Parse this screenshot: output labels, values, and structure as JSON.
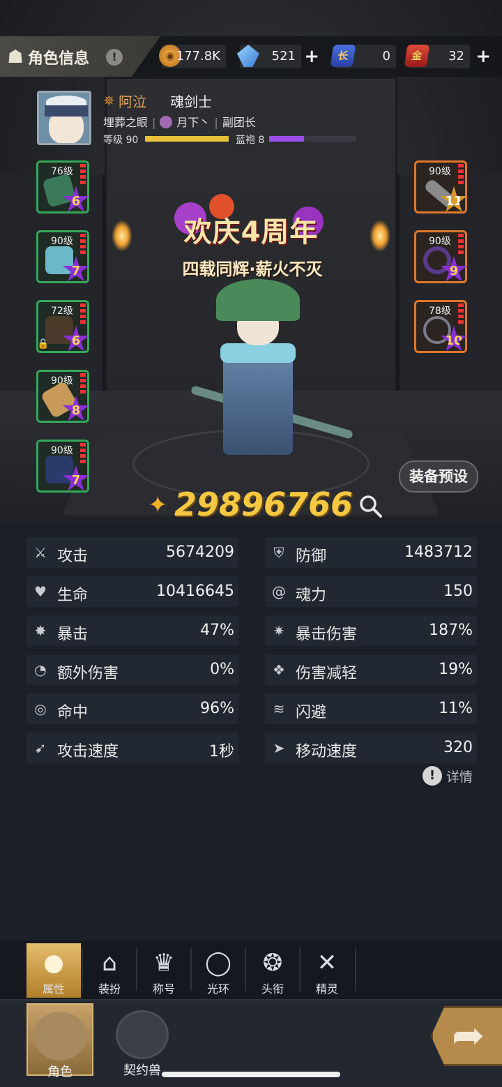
{
  "header": {
    "title": "角色信息",
    "info_symbol": "!",
    "resources": [
      {
        "icon": "gold-coin-icon",
        "value": "177.8K",
        "has_plus": false
      },
      {
        "icon": "blue-crystal-icon",
        "value": "521",
        "has_plus": true
      },
      {
        "icon": "card-long-icon",
        "icon_text": "长",
        "value": "0",
        "has_plus": false
      },
      {
        "icon": "card-gold-icon",
        "icon_text": "金",
        "value": "32",
        "has_plus": true
      }
    ]
  },
  "profile": {
    "name": "阿泣",
    "class": "魂剑士",
    "guild": "埋葬之眼",
    "title": "月下丶",
    "role": "副团长",
    "level_label": "等级 90",
    "rank_label": "蓝袍 8",
    "level_progress": 1.0,
    "rank_progress": 0.4
  },
  "equipment_left": [
    {
      "level": "76级",
      "stars": "6",
      "locked": false
    },
    {
      "level": "90级",
      "stars": "7",
      "locked": false
    },
    {
      "level": "72级",
      "stars": "6",
      "locked": true
    },
    {
      "level": "90级",
      "stars": "8",
      "locked": false
    },
    {
      "level": "90级",
      "stars": "7",
      "locked": false
    }
  ],
  "equipment_right": [
    {
      "level": "90级",
      "stars": "11",
      "gold": true
    },
    {
      "level": "90级",
      "stars": "9",
      "gold": false
    },
    {
      "level": "78级",
      "stars": "10",
      "gold": false
    }
  ],
  "banner": {
    "title": "欢庆4周年",
    "subtitle": "四载同辉·薪火不灭"
  },
  "preset_button": "装备预设",
  "combat_power": "29896766",
  "stats": [
    {
      "label": "攻击",
      "value": "5674209"
    },
    {
      "label": "防御",
      "value": "1483712"
    },
    {
      "label": "生命",
      "value": "10416645"
    },
    {
      "label": "魂力",
      "value": "150"
    },
    {
      "label": "暴击",
      "value": "47%"
    },
    {
      "label": "暴击伤害",
      "value": "187%"
    },
    {
      "label": "额外伤害",
      "value": "0%"
    },
    {
      "label": "伤害减轻",
      "value": "19%"
    },
    {
      "label": "命中",
      "value": "96%"
    },
    {
      "label": "闪避",
      "value": "11%"
    },
    {
      "label": "攻击速度",
      "value": "1秒"
    },
    {
      "label": "移动速度",
      "value": "320"
    }
  ],
  "detail_link": "详情",
  "tabs": [
    "属性",
    "装扮",
    "称号",
    "光环",
    "头衔",
    "精灵"
  ],
  "bottom_nav": [
    "角色",
    "契约兽"
  ],
  "colors": {
    "accent_gold": "#f6c842",
    "equip_green": "#35a858",
    "equip_orange": "#e0772a",
    "rank_purple": "#9a4ee8"
  }
}
